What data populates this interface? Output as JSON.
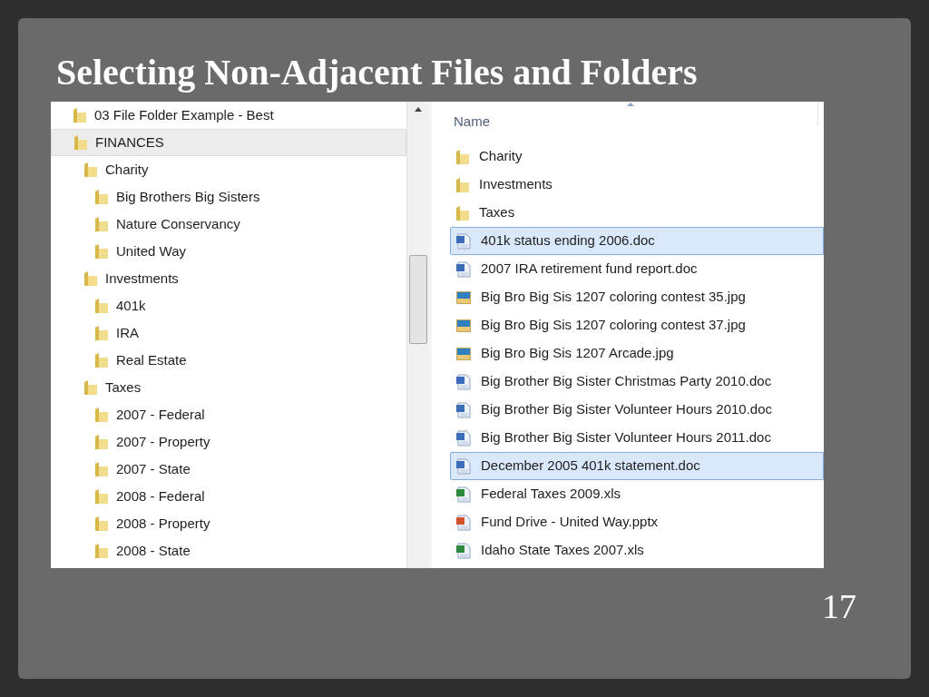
{
  "slide": {
    "title": "Selecting Non-Adjacent Files and Folders",
    "page_number": "17"
  },
  "navigation_tree": [
    {
      "label": "03 File Folder Example - Best",
      "selected": false
    },
    {
      "label": "FINANCES",
      "selected": true,
      "children": [
        {
          "label": "Charity",
          "selected": false,
          "children": [
            {
              "label": "Big Brothers Big Sisters",
              "selected": false
            },
            {
              "label": "Nature Conservancy",
              "selected": false
            },
            {
              "label": "United Way",
              "selected": false
            }
          ]
        },
        {
          "label": "Investments",
          "selected": false,
          "children": [
            {
              "label": "401k",
              "selected": false
            },
            {
              "label": "IRA",
              "selected": false
            },
            {
              "label": "Real Estate",
              "selected": false
            }
          ]
        },
        {
          "label": "Taxes",
          "selected": false,
          "children": [
            {
              "label": "2007 - Federal",
              "selected": false
            },
            {
              "label": "2007 - Property",
              "selected": false
            },
            {
              "label": "2007 - State",
              "selected": false
            },
            {
              "label": "2008 - Federal",
              "selected": false
            },
            {
              "label": "2008 - Property",
              "selected": false
            },
            {
              "label": "2008 - State",
              "selected": false
            }
          ]
        }
      ]
    }
  ],
  "file_list": {
    "column_header": "Name",
    "items": [
      {
        "name": "Charity",
        "kind": "folder",
        "selected": false
      },
      {
        "name": "Investments",
        "kind": "folder",
        "selected": false
      },
      {
        "name": "Taxes",
        "kind": "folder",
        "selected": false
      },
      {
        "name": "401k status ending 2006.doc",
        "kind": "doc",
        "selected": true
      },
      {
        "name": "2007 IRA retirement fund report.doc",
        "kind": "doc",
        "selected": false
      },
      {
        "name": "Big Bro Big Sis 1207 coloring contest 35.jpg",
        "kind": "image",
        "selected": false
      },
      {
        "name": "Big Bro Big Sis 1207 coloring contest 37.jpg",
        "kind": "image",
        "selected": false
      },
      {
        "name": "Big Bro Big Sis 1207 Arcade.jpg",
        "kind": "image",
        "selected": false
      },
      {
        "name": "Big Brother Big Sister Christmas Party 2010.doc",
        "kind": "doc",
        "selected": false
      },
      {
        "name": "Big Brother Big Sister Volunteer Hours 2010.doc",
        "kind": "doc",
        "selected": false
      },
      {
        "name": "Big Brother Big Sister Volunteer Hours 2011.doc",
        "kind": "doc",
        "selected": false
      },
      {
        "name": "December 2005 401k statement.doc",
        "kind": "doc",
        "selected": true
      },
      {
        "name": "Federal Taxes 2009.xls",
        "kind": "spreadsheet",
        "selected": false
      },
      {
        "name": "Fund Drive - United Way.pptx",
        "kind": "presentation",
        "selected": false
      },
      {
        "name": "Idaho State Taxes 2007.xls",
        "kind": "spreadsheet",
        "selected": false
      }
    ]
  }
}
